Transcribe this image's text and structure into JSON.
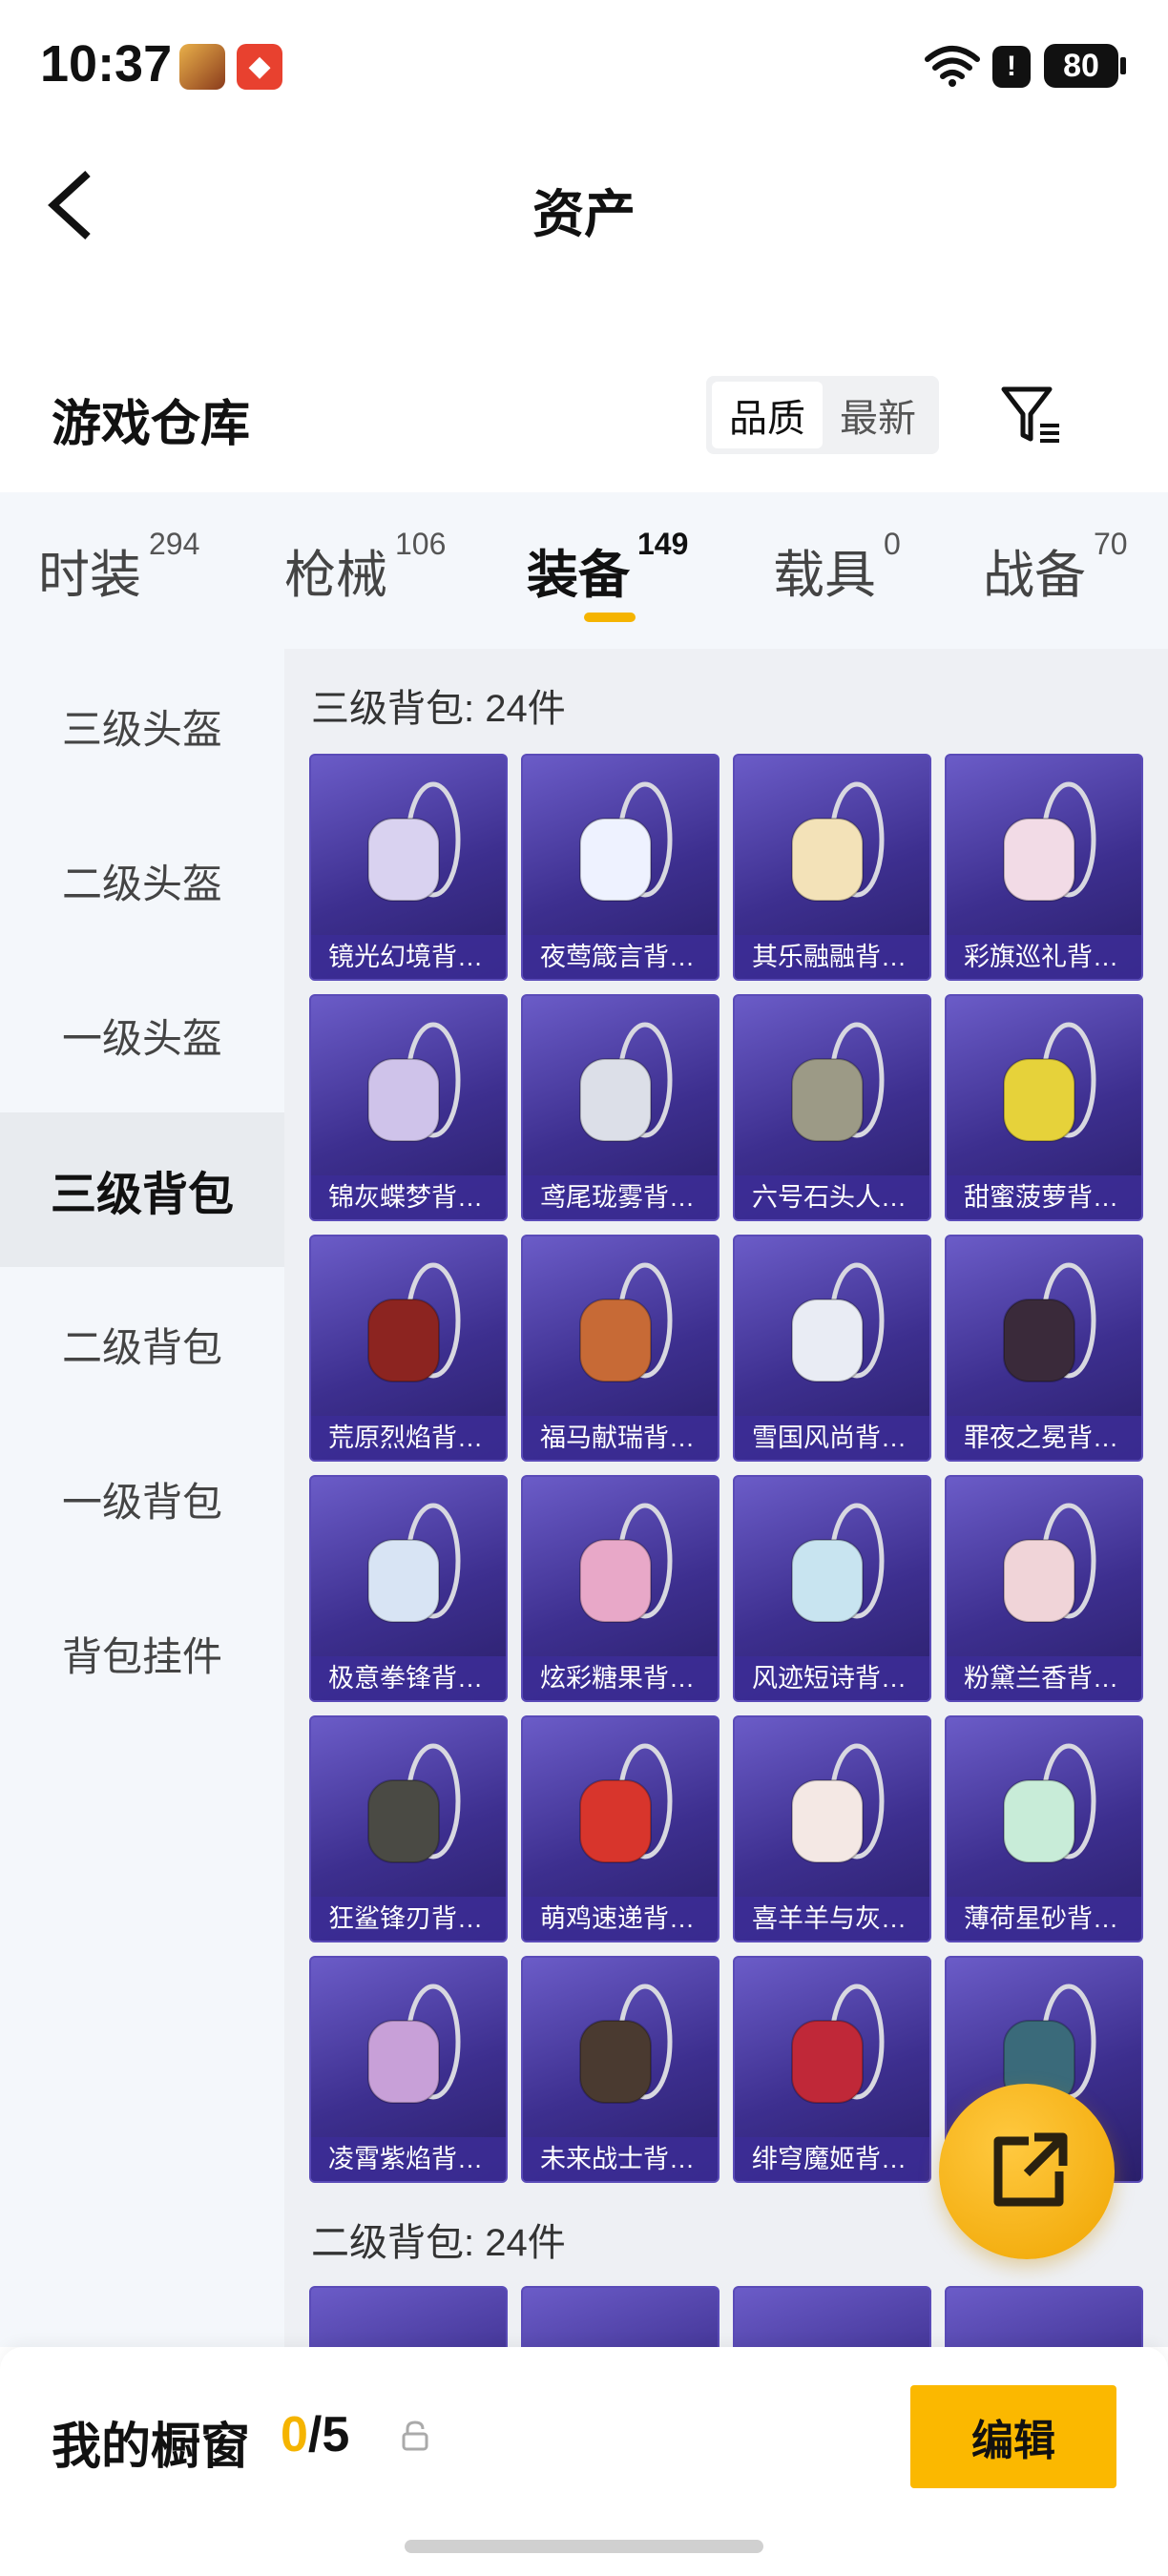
{
  "status_bar": {
    "time": "10:37",
    "battery": "80",
    "icons": [
      "game-app-icon",
      "shield-app-icon",
      "wifi-icon",
      "alert-icon",
      "battery-icon"
    ]
  },
  "header": {
    "title": "资产",
    "back_icon": "chevron-left-icon"
  },
  "warehouse": {
    "title": "游戏仓库",
    "sort_options": [
      "品质",
      "最新"
    ],
    "selected_sort": "品质",
    "filter_icon": "filter-icon"
  },
  "tabs": [
    {
      "label": "时装",
      "count": "294"
    },
    {
      "label": "枪械",
      "count": "106"
    },
    {
      "label": "装备",
      "count": "149"
    },
    {
      "label": "载具",
      "count": "0"
    },
    {
      "label": "战备",
      "count": "70"
    }
  ],
  "active_tab": "装备",
  "sidebar": {
    "items": [
      "三级头盔",
      "二级头盔",
      "一级头盔",
      "三级背包",
      "二级背包",
      "一级背包",
      "背包挂件"
    ],
    "active": "三级背包"
  },
  "sections": [
    {
      "title": "三级背包: 24件",
      "items": [
        "镜光幻境背…",
        "夜莺箴言背…",
        "其乐融融背…",
        "彩旗巡礼背…",
        "锦灰蝶梦背…",
        "鸢尾珑雾背…",
        "六号石头人…",
        "甜蜜菠萝背…",
        "荒原烈焰背…",
        "福马献瑞背…",
        "雪国风尚背…",
        "罪夜之冕背…",
        "极意拳锋背…",
        "炫彩糖果背…",
        "风迹短诗背…",
        "粉黛兰香背…",
        "狂鲨锋刃背…",
        "萌鸡速递背…",
        "喜羊羊与灰…",
        "薄荷星砂背…",
        "凌霄紫焰背…",
        "未来战士背…",
        "绯穹魔姬背…",
        ""
      ]
    },
    {
      "title": "二级背包: 24件"
    }
  ],
  "fab": {
    "icon": "share-external-icon"
  },
  "bottom": {
    "showcase_label": "我的橱窗",
    "current": "0",
    "separator": "/",
    "total": "5",
    "lock_icon": "lock-icon",
    "edit_label": "编辑"
  },
  "colors": {
    "accent": "#f5b400",
    "card_bg": "#4a3aa8"
  }
}
